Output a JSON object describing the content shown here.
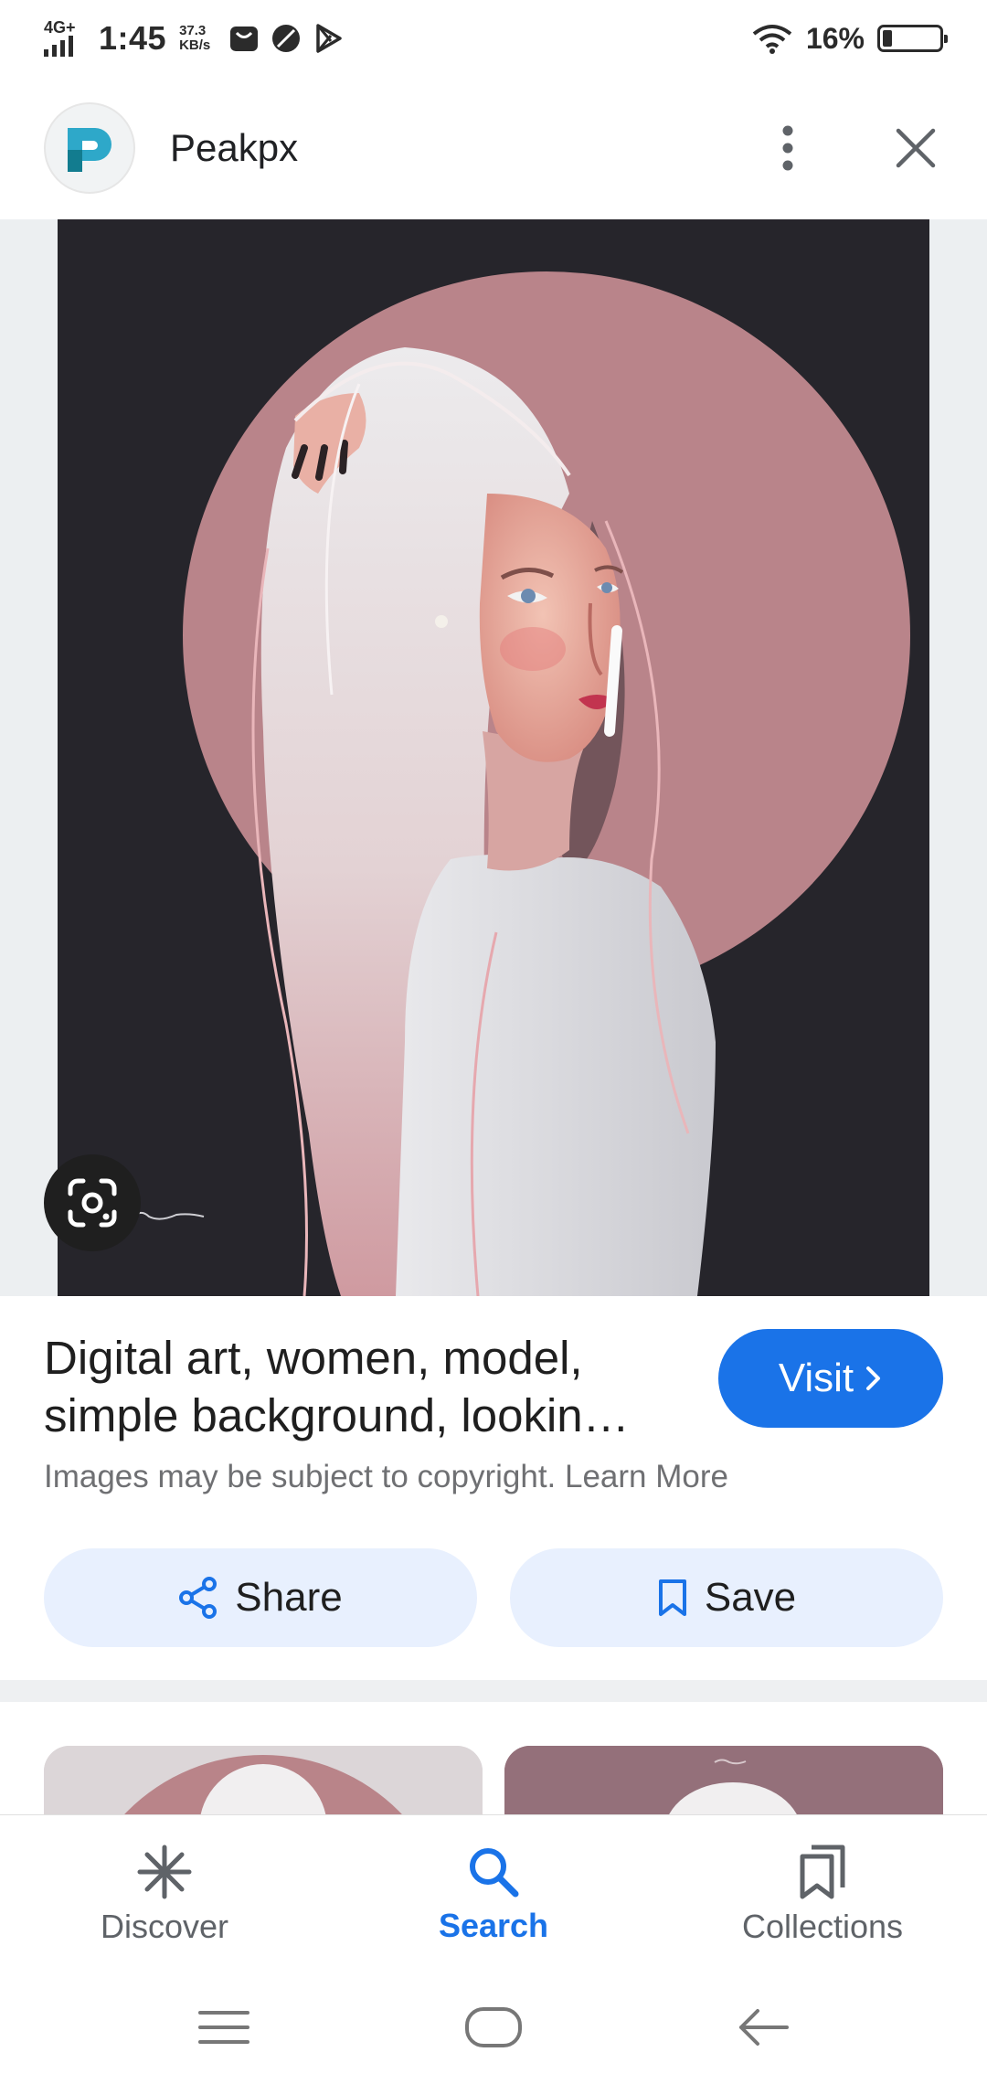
{
  "status_bar": {
    "network": "4G+",
    "time": "1:45",
    "speed_value": "37.3",
    "speed_unit": "KB/s",
    "battery_percent": "16%",
    "battery_level": 0.16
  },
  "header": {
    "site_name": "Peakpx",
    "logo_icon": "peakpx-logo",
    "menu_icon": "more-vert-icon",
    "close_icon": "close-icon"
  },
  "image": {
    "lens_icon": "google-lens-icon"
  },
  "result": {
    "title": "Digital art, women, model, simple background, lookin…",
    "visit_label": "Visit",
    "copyright_text": "Images may be subject to copyright. Learn More"
  },
  "actions": {
    "share_label": "Share",
    "save_label": "Save"
  },
  "bottom_nav": {
    "items": [
      {
        "label": "Discover",
        "icon": "asterisk-icon",
        "active": false
      },
      {
        "label": "Search",
        "icon": "search-icon",
        "active": true
      },
      {
        "label": "Collections",
        "icon": "collections-icon",
        "active": false
      }
    ]
  },
  "colors": {
    "accent": "#1a73e8",
    "pill_bg": "#e8f0fe",
    "artwork_bg": "#26252b",
    "artwork_circle": "#b9848a"
  }
}
